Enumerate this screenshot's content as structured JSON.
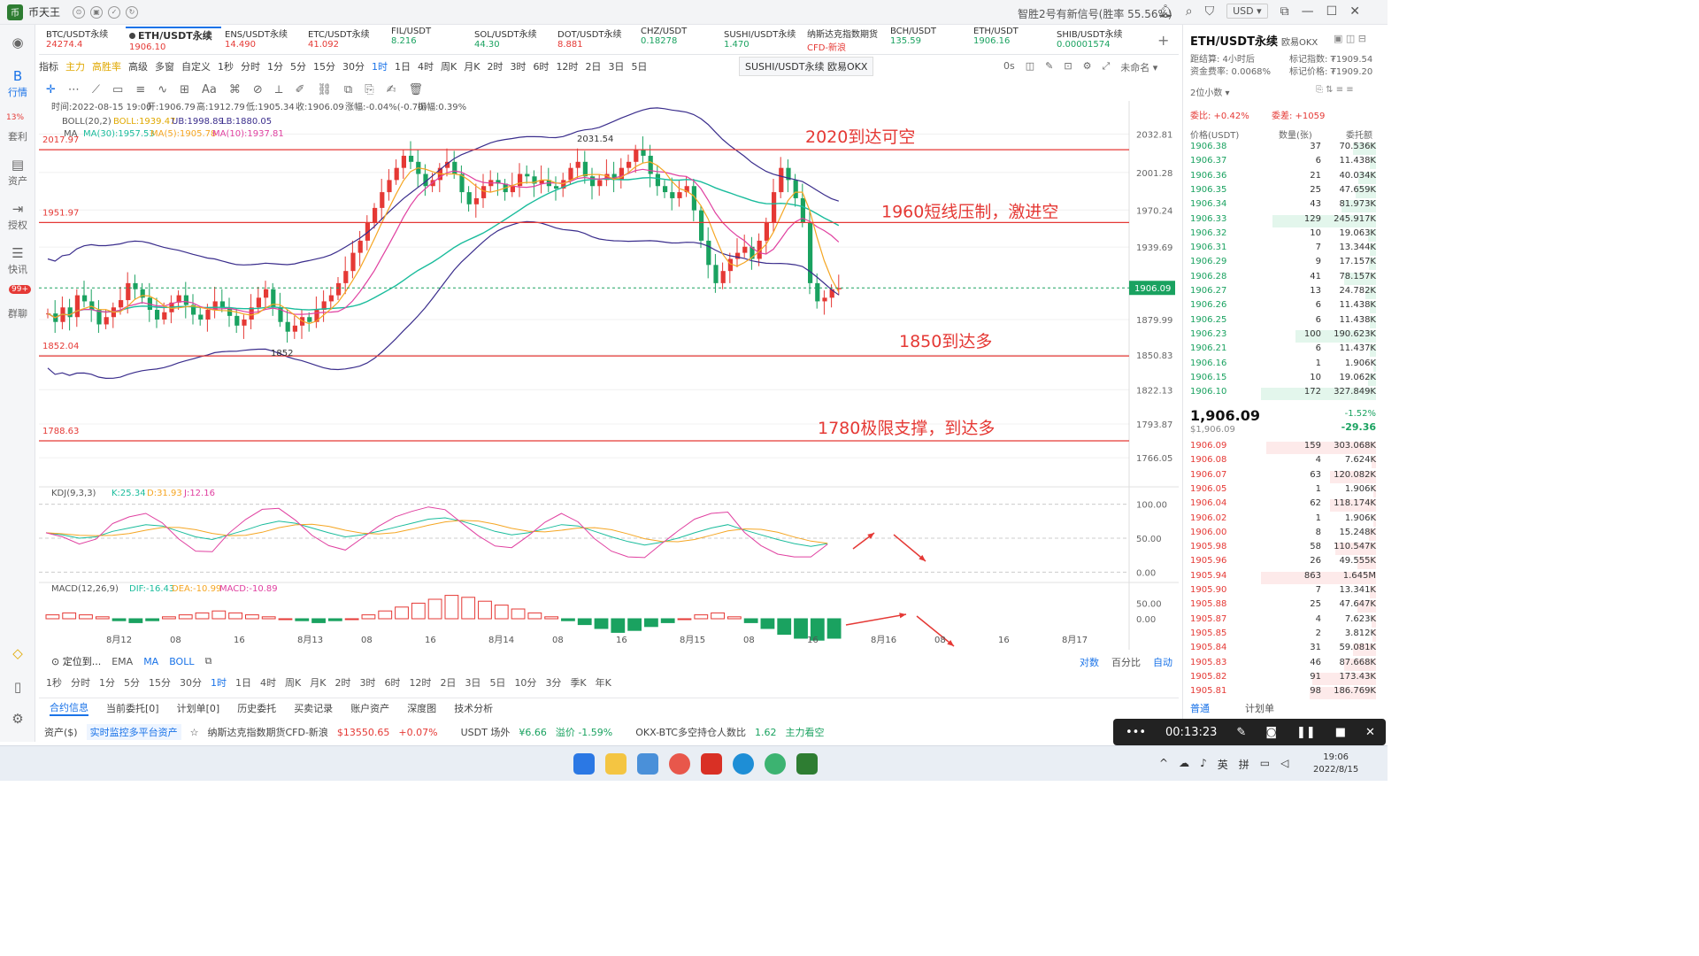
{
  "app": {
    "title": "币天王",
    "signal_text": "智胜2号有新信号(胜率 55.56%)",
    "currency": "USD"
  },
  "nav": [
    {
      "label": "行情",
      "icon": "B"
    },
    {
      "label": "套利",
      "icon": "利"
    },
    {
      "label": "资产",
      "icon": "产"
    },
    {
      "label": "授权",
      "icon": "权"
    },
    {
      "label": "快讯",
      "icon": "讯"
    },
    {
      "label": "群聊",
      "icon": "聊"
    }
  ],
  "nav_badges": {
    "arb": "13%",
    "chat": "99+"
  },
  "tabs": [
    {
      "name": "BTC/USDT永续",
      "price": "24274.4",
      "up": true
    },
    {
      "name": "ETH/USDT永续",
      "price": "1906.10",
      "up": true
    },
    {
      "name": "ENS/USDT永续",
      "price": "14.490",
      "up": true
    },
    {
      "name": "ETC/USDT永续",
      "price": "41.092",
      "up": true
    },
    {
      "name": "FIL/USDT",
      "price": "8.216",
      "up": false
    },
    {
      "name": "SOL/USDT永续",
      "price": "44.30",
      "up": false
    },
    {
      "name": "DOT/USDT永续",
      "price": "8.881",
      "up": true
    },
    {
      "name": "CHZ/USDT",
      "price": "0.18278",
      "up": false
    },
    {
      "name": "SUSHI/USDT永续",
      "price": "1.470",
      "up": false
    },
    {
      "name": "纳斯达克指数期货",
      "price": "CFD-新浪",
      "up": true
    },
    {
      "name": "BCH/USDT",
      "price": "135.59",
      "up": false
    },
    {
      "name": "ETH/USDT",
      "price": "1906.16",
      "up": false
    },
    {
      "name": "SHIB/USDT永续",
      "price": "0.00001574",
      "up": false
    }
  ],
  "toolbar": {
    "items": [
      "指标",
      "主力",
      "高胜率",
      "高级",
      "多窗",
      "自定义",
      "1秒",
      "分时",
      "1分",
      "5分",
      "15分",
      "30分",
      "1时",
      "1日",
      "4时",
      "周K",
      "月K",
      "2时",
      "3时",
      "6时",
      "12时",
      "2日",
      "3日",
      "5日"
    ],
    "active": "1时"
  },
  "tooltip": "SUSHI/USDT永续 欧易OKX",
  "toolbar_right": [
    "0s",
    "未命名"
  ],
  "ohlc": {
    "time": "时间:2022-08-15 19:00",
    "open": "开:1906.79",
    "high": "高:1912.79",
    "low": "低:1905.34",
    "close": "收:1906.09",
    "chg": "涨幅:-0.04%(-0.70)",
    "amp": "振幅:0.39%"
  },
  "boll": {
    "label": "BOLL(20,2)",
    "boll": "BOLL:1939.47",
    "ub": "UB:1998.89",
    "lb": "LB:1880.05"
  },
  "ma": {
    "label": "MA",
    "ma30": "MA(30):1957.53",
    "ma5": "MA(5):1905.78",
    "ma10": "MA(10):1937.81"
  },
  "kdj": {
    "label": "KDJ(9,3,3)",
    "k": "K:25.34",
    "d": "D:31.93",
    "j": "J:12.16"
  },
  "macd": {
    "label": "MACD(12,26,9)",
    "dif": "DIF:-16.43",
    "dea": "DEA:-10.99",
    "macd": "MACD:-10.89"
  },
  "annotations": {
    "a1": "2020到达可空",
    "a2": "1960短线压制，激进空",
    "a3": "1850到达多",
    "a4": "1780极限支撑，到达多"
  },
  "chart_data": {
    "type": "candlestick",
    "symbol": "ETH/USDT永续",
    "interval": "1时",
    "price_axis_ticks": [
      2032.81,
      2001.28,
      1970.24,
      1939.69,
      1879.99,
      1850.83,
      1822.13,
      1793.87,
      1766.05
    ],
    "price_ylim": [
      1745,
      2050
    ],
    "horizontal_lines": [
      2020,
      1960,
      1850,
      1780
    ],
    "line_labels": [
      2017.97,
      1951.97,
      1852.04,
      1788.63
    ],
    "max_label": "2031.54",
    "min_label": "1852",
    "current_price": "1906.09",
    "x_ticks": [
      "8月12",
      "08",
      "16",
      "8月13",
      "08",
      "16",
      "8月14",
      "08",
      "16",
      "8月15",
      "08",
      "16",
      "8月16",
      "08",
      "16",
      "8月17"
    ],
    "kdj_ticks": [
      "100.00",
      "50.00",
      "0.00"
    ],
    "macd_ticks": [
      "50.00",
      "0.00"
    ],
    "close_series": [
      1885,
      1878,
      1890,
      1882,
      1900,
      1895,
      1888,
      1876,
      1882,
      1890,
      1896,
      1910,
      1905,
      1898,
      1888,
      1880,
      1886,
      1894,
      1900,
      1892,
      1884,
      1880,
      1888,
      1895,
      1890,
      1883,
      1875,
      1880,
      1890,
      1898,
      1905,
      1890,
      1878,
      1870,
      1875,
      1882,
      1878,
      1888,
      1895,
      1900,
      1910,
      1920,
      1935,
      1945,
      1960,
      1972,
      1985,
      1995,
      2005,
      2015,
      2010,
      2000,
      1990,
      1995,
      2005,
      2010,
      2000,
      1985,
      1975,
      1980,
      1990,
      1995,
      1992,
      1985,
      1990,
      2000,
      1998,
      1992,
      1995,
      1990,
      1988,
      1995,
      2005,
      2010,
      1998,
      1990,
      1995,
      2000,
      1995,
      2005,
      2010,
      2020,
      2015,
      2000,
      1990,
      1985,
      1980,
      1985,
      1990,
      1970,
      1945,
      1925,
      1910,
      1920,
      1930,
      1935,
      1940,
      1930,
      1945,
      1960,
      1985,
      2005,
      1995,
      1980,
      1960,
      1910,
      1895,
      1898,
      1905,
      1906
    ],
    "kdj_k": [
      58,
      55,
      50,
      52,
      60,
      65,
      70,
      68,
      60,
      52,
      48,
      55,
      62,
      70,
      75,
      72,
      65,
      58,
      52,
      55,
      60,
      66,
      72,
      78,
      80,
      75,
      68,
      60,
      55,
      58,
      64,
      70,
      68,
      60,
      52,
      45,
      40,
      44,
      50,
      58,
      65,
      70,
      62,
      55,
      48,
      42,
      38,
      42
    ],
    "macd_hist": [
      2,
      3,
      2,
      1,
      -1,
      -2,
      -1,
      1,
      2,
      3,
      4,
      3,
      2,
      1,
      0,
      -1,
      -2,
      -1,
      0,
      2,
      4,
      6,
      8,
      10,
      12,
      11,
      9,
      7,
      5,
      3,
      1,
      -1,
      -3,
      -5,
      -7,
      -6,
      -4,
      -2,
      0,
      2,
      3,
      1,
      -2,
      -5,
      -8,
      -10,
      -11,
      -10
    ]
  },
  "orderbook": {
    "title": "ETH/USDT永续",
    "exchange": "欧易OKX",
    "info": {
      "maturity": "距结算: 4小时后",
      "funding": "资金费率: 0.0068%",
      "index": "标记指数: ₮1909.54",
      "mark": "标记价格: ₮1909.20"
    },
    "precision": "2位小数",
    "ratio": {
      "wb": "委比: +0.42%",
      "wc": "委差: +1059"
    },
    "headers": [
      "价格(USDT)",
      "数量(张)",
      "委托额"
    ],
    "asks": [
      [
        "1906.38",
        "37",
        "70.536K",
        0.2
      ],
      [
        "1906.37",
        "6",
        "11.438K",
        0.05
      ],
      [
        "1906.36",
        "21",
        "40.034K",
        0.15
      ],
      [
        "1906.35",
        "25",
        "47.659K",
        0.18
      ],
      [
        "1906.34",
        "43",
        "81.973K",
        0.3
      ],
      [
        "1906.33",
        "129",
        "245.917K",
        0.9
      ],
      [
        "1906.32",
        "10",
        "19.063K",
        0.07
      ],
      [
        "1906.31",
        "7",
        "13.344K",
        0.05
      ],
      [
        "1906.29",
        "9",
        "17.157K",
        0.06
      ],
      [
        "1906.28",
        "41",
        "78.157K",
        0.28
      ],
      [
        "1906.27",
        "13",
        "24.782K",
        0.09
      ],
      [
        "1906.26",
        "6",
        "11.438K",
        0.05
      ],
      [
        "1906.25",
        "6",
        "11.438K",
        0.05
      ],
      [
        "1906.23",
        "100",
        "190.623K",
        0.7
      ],
      [
        "1906.21",
        "6",
        "11.437K",
        0.05
      ],
      [
        "1906.16",
        "1",
        "1.906K",
        0.02
      ],
      [
        "1906.15",
        "10",
        "19.062K",
        0.07
      ],
      [
        "1906.10",
        "172",
        "327.849K",
        1.0
      ]
    ],
    "last": {
      "price": "1,906.09",
      "sub": "$1,906.09",
      "chg_pct": "-1.52%",
      "chg": "-29.36"
    },
    "bids": [
      [
        "1906.09",
        "159",
        "303.068K",
        0.95
      ],
      [
        "1906.08",
        "4",
        "7.624K",
        0.04
      ],
      [
        "1906.07",
        "63",
        "120.082K",
        0.4
      ],
      [
        "1906.05",
        "1",
        "1.906K",
        0.02
      ],
      [
        "1906.04",
        "62",
        "118.174K",
        0.4
      ],
      [
        "1906.02",
        "1",
        "1.906K",
        0.02
      ],
      [
        "1906.00",
        "8",
        "15.248K",
        0.06
      ],
      [
        "1905.98",
        "58",
        "110.547K",
        0.35
      ],
      [
        "1905.96",
        "26",
        "49.555K",
        0.16
      ],
      [
        "1905.94",
        "863",
        "1.645M",
        1.0
      ],
      [
        "1905.90",
        "7",
        "13.341K",
        0.05
      ],
      [
        "1905.88",
        "25",
        "47.647K",
        0.16
      ],
      [
        "1905.87",
        "4",
        "7.623K",
        0.04
      ],
      [
        "1905.85",
        "2",
        "3.812K",
        0.03
      ],
      [
        "1905.84",
        "31",
        "59.081K",
        0.2
      ],
      [
        "1905.83",
        "46",
        "87.668K",
        0.28
      ],
      [
        "1905.82",
        "91",
        "173.43K",
        0.55
      ],
      [
        "1905.81",
        "98",
        "186.769K",
        0.58
      ]
    ],
    "bottom_tabs": [
      "普通",
      "计划单"
    ]
  },
  "bottom": {
    "left": "定位到...",
    "indicators": [
      "EMA",
      "MA",
      "BOLL"
    ],
    "right": [
      "对数",
      "百分比",
      "自动"
    ],
    "intervals": [
      "1秒",
      "分时",
      "1分",
      "5分",
      "15分",
      "30分",
      "1时",
      "1日",
      "4时",
      "周K",
      "月K",
      "2时",
      "3时",
      "6时",
      "12时",
      "2日",
      "3日",
      "5日",
      "10分",
      "3分",
      "季K",
      "年K"
    ],
    "active_interval": "1时",
    "tabs": [
      "合约信息",
      "当前委托[0]",
      "计划单[0]",
      "历史委托",
      "买卖记录",
      "账户资产",
      "深度图",
      "技术分析"
    ]
  },
  "status": {
    "asset": "资产($)",
    "monitor": "实时监控多平台资产",
    "nasdaq": "纳斯达克指数期货CFD-新浪",
    "nasdaq_price": "$13550.65",
    "nasdaq_chg": "+0.07%",
    "usdt": "USDT 场外",
    "usdt_price": "¥6.66",
    "premium": "溢价 -1.59%",
    "okx": "OKX-BTC多空持仓人数比",
    "okx_val": "1.62",
    "okx_note": "主力看空"
  },
  "recorder": {
    "time": "00:13:23"
  },
  "taskbar": {
    "tray": [
      "英",
      "拼"
    ],
    "time": "19:06",
    "date": "2022/8/15"
  }
}
